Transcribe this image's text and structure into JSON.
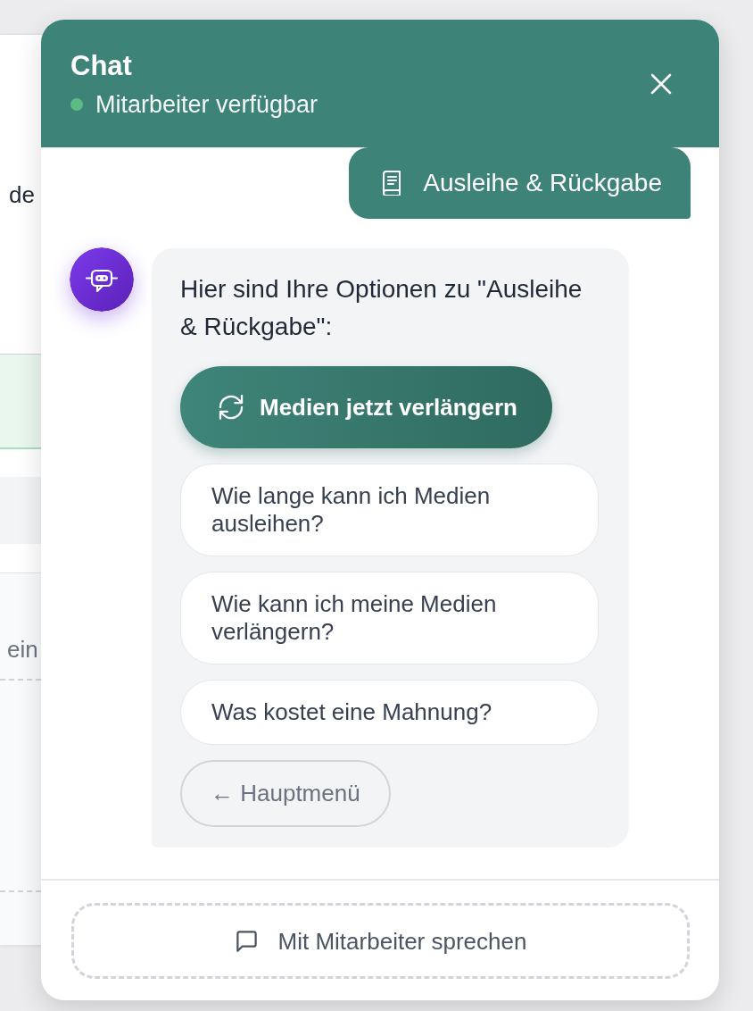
{
  "background_page": {
    "heading": "de",
    "field_text": "ein"
  },
  "header": {
    "title": "Chat",
    "status": {
      "label": "Mitarbeiter verfügbar",
      "online": true
    }
  },
  "messages": [
    {
      "kind": "user",
      "text": "Ausleihe & Rückgabe"
    },
    {
      "kind": "bot",
      "text": "Hier sind Ihre Optionen zu \"Ausleihe & Rückgabe\":",
      "options": [
        {
          "kind": "primary",
          "label": "Medien jetzt verlängern"
        },
        {
          "kind": "option",
          "label": "Wie lange kann ich Medien ausleihen?"
        },
        {
          "kind": "option",
          "label": "Wie kann ich meine Medien verlängern?"
        },
        {
          "kind": "option",
          "label": "Was kostet eine Mahnung?"
        },
        {
          "kind": "back",
          "label": "← Hauptmenü"
        }
      ]
    }
  ],
  "footer": {
    "button": "Mit Mitarbeiter sprechen"
  }
}
